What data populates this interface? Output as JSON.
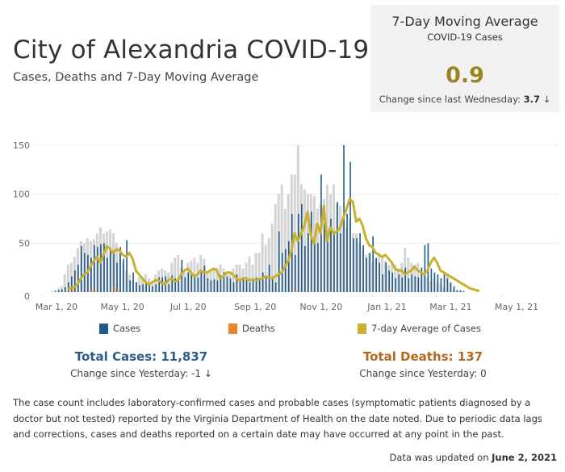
{
  "header": {
    "title": "City of Alexandria COVID-19",
    "subtitle": "Cases, Deaths  and 7-Day Moving Average"
  },
  "kpi": {
    "title": "7-Day Moving Average",
    "subtitle": "COVID-19 Cases",
    "value": "0.9",
    "change_label": "Change since last Wednesday:",
    "change_value": "3.7",
    "change_arrow": "↓"
  },
  "legend": {
    "items": [
      {
        "label": "Cases",
        "color": "#1f5a8b"
      },
      {
        "label": "Deaths",
        "color": "#e8852a"
      },
      {
        "label": "7-day Average of Cases",
        "color": "#c9b02f"
      }
    ]
  },
  "totals": {
    "cases_label": "Total Cases: 11,837",
    "cases_change": "Change since Yesterday: -1 ↓",
    "deaths_label": "Total Deaths: 137",
    "deaths_change": "Change since Yesterday: 0",
    "cases_color": "#2c5d8a",
    "deaths_color": "#b5681f"
  },
  "footer": {
    "note": "The case count includes laboratory-confirmed cases and probable cases (symptomatic patients diagnosed by a doctor but not tested) reported by the Virginia Department of Health on the date noted. Due to periodic data lags and corrections, cases and deaths reported on a certain date may have occurred at any point in the past.",
    "updated_prefix": "Data was updated on ",
    "updated_date": "June 2, 2021"
  },
  "chart_data": {
    "type": "bar",
    "title": "Cases, Deaths and 7-Day Moving Average",
    "xlabel": "",
    "ylabel": "",
    "ylim": [
      0,
      170
    ],
    "yticks": [
      0,
      50,
      100,
      150
    ],
    "grid": true,
    "legend_position": "bottom",
    "x_tick_labels": [
      "Mar 1, 20",
      "May 1, 20",
      "Jul 1, 20",
      "Sep 1, 20",
      "Nov 1, 20",
      "Jan 1, 21",
      "Mar 1, 21",
      "May 1, 21"
    ],
    "x_tick_day_offsets": [
      0,
      61,
      122,
      184,
      245,
      306,
      365,
      426
    ],
    "bin_days": 3,
    "start_day_offset": 8,
    "series": [
      {
        "name": "Cases",
        "color": "#1f5a8b",
        "values": [
          0,
          1,
          2,
          3,
          5,
          10,
          16,
          22,
          28,
          47,
          40,
          38,
          35,
          48,
          46,
          49,
          50,
          35,
          45,
          40,
          30,
          46,
          34,
          53,
          12,
          20,
          10,
          7,
          8,
          10,
          9,
          6,
          8,
          15,
          15,
          16,
          8,
          17,
          14,
          12,
          33,
          15,
          20,
          18,
          17,
          15,
          20,
          27,
          14,
          12,
          13,
          12,
          17,
          20,
          16,
          14,
          10,
          18,
          12,
          14,
          15,
          10,
          13,
          15,
          12,
          20,
          15,
          28,
          14,
          10,
          62,
          40,
          44,
          52,
          80,
          38,
          80,
          90,
          47,
          60,
          82,
          55,
          50,
          120,
          70,
          55,
          75,
          60,
          92,
          60,
          150,
          80,
          133,
          55,
          55,
          60,
          48,
          35,
          40,
          57,
          35,
          30,
          18,
          30,
          22,
          20,
          14,
          18,
          15,
          25,
          14,
          18,
          16,
          15,
          25,
          48,
          50,
          24,
          20,
          18,
          14,
          18,
          14,
          10,
          6,
          2,
          2,
          1,
          0
        ],
        "shade_values": [
          1,
          2,
          4,
          6,
          18,
          28,
          30,
          36,
          45,
          52,
          50,
          55,
          52,
          54,
          60,
          66,
          60,
          62,
          64,
          60,
          50,
          40,
          30,
          22,
          18,
          12,
          10,
          15,
          15,
          18,
          14,
          10,
          18,
          22,
          24,
          22,
          20,
          30,
          35,
          38,
          25,
          20,
          30,
          32,
          35,
          30,
          38,
          34,
          20,
          22,
          25,
          25,
          28,
          24,
          20,
          20,
          24,
          28,
          28,
          24,
          30,
          36,
          28,
          40,
          40,
          60,
          48,
          55,
          70,
          90,
          100,
          110,
          85,
          100,
          120,
          120,
          150,
          110,
          105,
          100,
          100,
          98,
          85,
          90,
          95,
          110,
          100,
          110,
          90,
          88,
          70,
          66,
          75,
          60,
          60,
          50,
          45,
          38,
          40,
          30,
          34,
          40,
          36,
          32,
          28,
          30,
          28,
          24,
          30,
          45,
          35,
          30,
          28,
          30,
          22,
          20,
          15,
          10,
          14,
          10,
          8,
          5,
          18,
          8,
          3,
          2,
          1,
          1,
          0
        ]
      },
      {
        "name": "Deaths",
        "color": "#e8852a",
        "values": [
          0,
          0,
          0,
          0,
          0,
          0,
          1,
          0,
          0,
          1,
          0,
          0,
          2,
          1,
          0,
          0,
          0,
          0,
          0,
          4,
          2,
          0,
          0,
          0,
          0,
          0,
          0,
          0,
          0,
          0,
          0,
          0,
          0,
          0,
          0,
          0,
          0,
          0,
          0,
          0,
          0,
          0,
          0,
          0,
          0,
          0,
          0,
          0,
          0,
          0,
          0,
          0,
          0,
          0,
          0,
          0,
          0,
          0,
          0,
          0,
          0,
          0,
          0,
          0,
          0,
          0,
          0,
          0,
          0,
          0,
          0,
          0,
          0,
          0,
          0,
          1,
          0,
          0,
          0,
          0,
          1,
          0,
          0,
          0,
          0,
          0,
          1,
          0,
          0,
          0,
          0,
          0,
          0,
          0,
          0,
          0,
          0,
          0,
          0,
          0,
          0,
          0,
          0,
          0,
          1,
          0,
          0,
          0,
          0,
          0,
          0,
          0,
          0,
          0,
          0,
          0,
          0,
          0,
          0,
          0,
          0,
          0,
          0,
          0,
          0,
          0,
          0,
          0,
          0
        ]
      },
      {
        "name": "7-day Average of Cases",
        "color": "#c9b02f",
        "type": "line",
        "values": [
          3,
          4,
          5,
          8,
          14,
          18,
          20,
          26,
          32,
          36,
          30,
          38,
          47,
          44,
          40,
          44,
          42,
          38,
          36,
          40,
          34,
          22,
          18,
          14,
          10,
          8,
          10,
          12,
          12,
          9,
          8,
          12,
          14,
          11,
          12,
          18,
          22,
          24,
          20,
          16,
          18,
          22,
          20,
          20,
          22,
          24,
          22,
          14,
          16,
          20,
          20,
          18,
          14,
          12,
          14,
          14,
          12,
          13,
          12,
          13,
          14,
          16,
          15,
          14,
          16,
          18,
          20,
          26,
          32,
          42,
          60,
          52,
          60,
          68,
          82,
          58,
          50,
          70,
          60,
          88,
          52,
          66,
          60,
          62,
          65,
          76,
          85,
          95,
          92,
          72,
          75,
          68,
          55,
          48,
          46,
          40,
          38,
          36,
          38,
          34,
          30,
          24,
          22,
          22,
          18,
          20,
          22,
          26,
          22,
          20,
          18,
          22,
          30,
          35,
          30,
          22,
          20,
          18,
          16,
          14,
          12,
          10,
          8,
          6,
          4,
          3,
          2,
          1
        ]
      }
    ]
  }
}
